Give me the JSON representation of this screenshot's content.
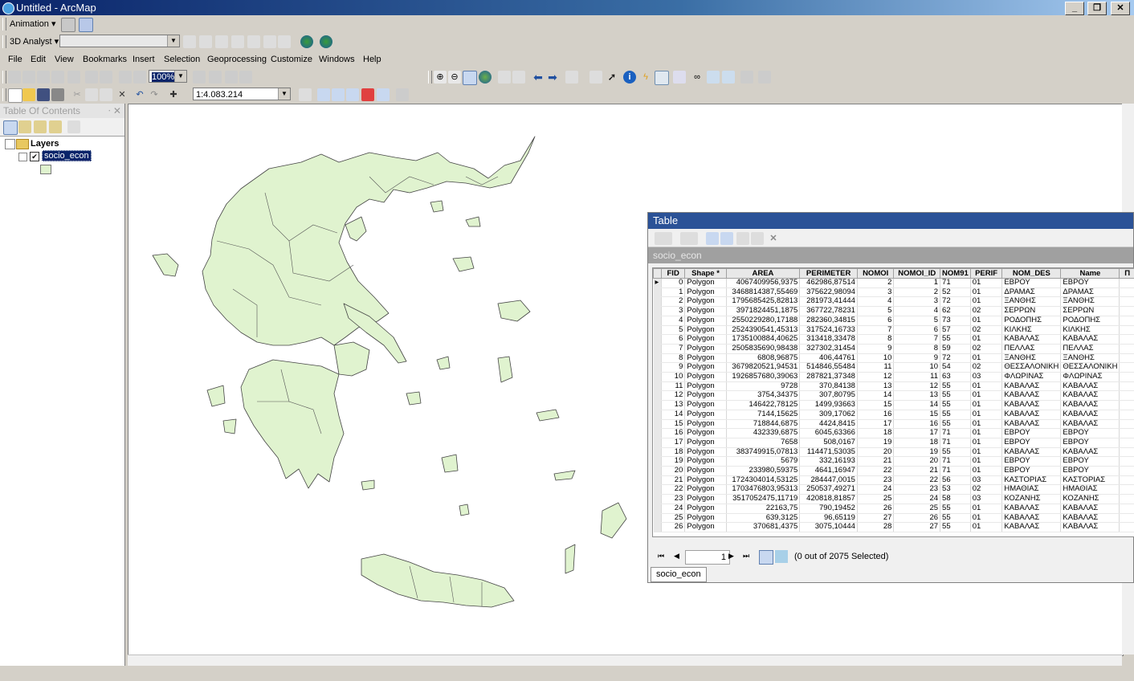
{
  "window": {
    "title": "Untitled - ArcMap",
    "min": "_",
    "max": "❐",
    "close": "✕"
  },
  "toolbar1": {
    "animation": "Animation ▾"
  },
  "toolbar2": {
    "analyst": "3D Analyst ▾"
  },
  "menu": [
    "File",
    "Edit",
    "View",
    "Bookmarks",
    "Insert",
    "Selection",
    "Geoprocessing",
    "Customize",
    "Windows",
    "Help"
  ],
  "zoom_percent": "100%",
  "scale": "1:4.083.214",
  "toc": {
    "title": "Table Of Contents",
    "pin": "ᐧ ✕",
    "root": "Layers",
    "layer": "socio_econ",
    "expand_root": "⊟",
    "expand_layer": "⊟",
    "check": "✔"
  },
  "table": {
    "window_title": "Table",
    "table_name": "socio_econ",
    "columns": [
      "FID",
      "Shape *",
      "AREA",
      "PERIMETER",
      "NOMOI",
      "NOMOI_ID",
      "NOM91",
      "PERIF",
      "NOM_DES",
      "Name",
      "Π"
    ],
    "rows": [
      [
        "0",
        "Polygon",
        "4067409956,9375",
        "462986,87514",
        "2",
        "1",
        "71",
        "01",
        "ΕΒΡΟΥ",
        "ΕΒΡΟΥ"
      ],
      [
        "1",
        "Polygon",
        "3468814387,55469",
        "375622,98094",
        "3",
        "2",
        "52",
        "01",
        "ΔΡΑΜΑΣ",
        "ΔΡΑΜΑΣ"
      ],
      [
        "2",
        "Polygon",
        "1795685425,82813",
        "281973,41444",
        "4",
        "3",
        "72",
        "01",
        "ΞΑΝΘΗΣ",
        "ΞΑΝΘΗΣ"
      ],
      [
        "3",
        "Polygon",
        "3971824451,1875",
        "367722,78231",
        "5",
        "4",
        "62",
        "02",
        "ΣΕΡΡΩΝ",
        "ΣΕΡΡΩΝ"
      ],
      [
        "4",
        "Polygon",
        "2550229280,17188",
        "282360,34815",
        "6",
        "5",
        "73",
        "01",
        "ΡΟΔΟΠΗΣ",
        "ΡΟΔΟΠΗΣ"
      ],
      [
        "5",
        "Polygon",
        "2524390541,45313",
        "317524,16733",
        "7",
        "6",
        "57",
        "02",
        "ΚΙΛΚΗΣ",
        "ΚΙΛΚΗΣ"
      ],
      [
        "6",
        "Polygon",
        "1735100884,40625",
        "313418,33478",
        "8",
        "7",
        "55",
        "01",
        "ΚΑΒΑΛΑΣ",
        "ΚΑΒΑΛΑΣ"
      ],
      [
        "7",
        "Polygon",
        "2505835690,98438",
        "327302,31454",
        "9",
        "8",
        "59",
        "02",
        "ΠΕΛΛΑΣ",
        "ΠΕΛΛΑΣ"
      ],
      [
        "8",
        "Polygon",
        "6808,96875",
        "406,44761",
        "10",
        "9",
        "72",
        "01",
        "ΞΑΝΘΗΣ",
        "ΞΑΝΘΗΣ"
      ],
      [
        "9",
        "Polygon",
        "3679820521,94531",
        "514846,55484",
        "11",
        "10",
        "54",
        "02",
        "ΘΕΣΣΑΛΟΝΙΚΗ",
        "ΘΕΣΣΑΛΟΝΙΚΗ"
      ],
      [
        "10",
        "Polygon",
        "1926857680,39063",
        "287821,37348",
        "12",
        "11",
        "63",
        "03",
        "ΦΛΩΡΙΝΑΣ",
        "ΦΛΩΡΙΝΑΣ"
      ],
      [
        "11",
        "Polygon",
        "9728",
        "370,84138",
        "13",
        "12",
        "55",
        "01",
        "ΚΑΒΑΛΑΣ",
        "ΚΑΒΑΛΑΣ"
      ],
      [
        "12",
        "Polygon",
        "3754,34375",
        "307,80795",
        "14",
        "13",
        "55",
        "01",
        "ΚΑΒΑΛΑΣ",
        "ΚΑΒΑΛΑΣ"
      ],
      [
        "13",
        "Polygon",
        "146422,78125",
        "1499,93663",
        "15",
        "14",
        "55",
        "01",
        "ΚΑΒΑΛΑΣ",
        "ΚΑΒΑΛΑΣ"
      ],
      [
        "14",
        "Polygon",
        "7144,15625",
        "309,17062",
        "16",
        "15",
        "55",
        "01",
        "ΚΑΒΑΛΑΣ",
        "ΚΑΒΑΛΑΣ"
      ],
      [
        "15",
        "Polygon",
        "718844,6875",
        "4424,8415",
        "17",
        "16",
        "55",
        "01",
        "ΚΑΒΑΛΑΣ",
        "ΚΑΒΑΛΑΣ"
      ],
      [
        "16",
        "Polygon",
        "432339,6875",
        "6045,63366",
        "18",
        "17",
        "71",
        "01",
        "ΕΒΡΟΥ",
        "ΕΒΡΟΥ"
      ],
      [
        "17",
        "Polygon",
        "7658",
        "508,0167",
        "19",
        "18",
        "71",
        "01",
        "ΕΒΡΟΥ",
        "ΕΒΡΟΥ"
      ],
      [
        "18",
        "Polygon",
        "383749915,07813",
        "114471,53035",
        "20",
        "19",
        "55",
        "01",
        "ΚΑΒΑΛΑΣ",
        "ΚΑΒΑΛΑΣ"
      ],
      [
        "19",
        "Polygon",
        "5679",
        "332,16193",
        "21",
        "20",
        "71",
        "01",
        "ΕΒΡΟΥ",
        "ΕΒΡΟΥ"
      ],
      [
        "20",
        "Polygon",
        "233980,59375",
        "4641,16947",
        "22",
        "21",
        "71",
        "01",
        "ΕΒΡΟΥ",
        "ΕΒΡΟΥ"
      ],
      [
        "21",
        "Polygon",
        "1724304014,53125",
        "284447,0015",
        "23",
        "22",
        "56",
        "03",
        "ΚΑΣΤΟΡΙΑΣ",
        "ΚΑΣΤΟΡΙΑΣ"
      ],
      [
        "22",
        "Polygon",
        "1703476803,95313",
        "250537,49271",
        "24",
        "23",
        "53",
        "02",
        "ΗΜΑΘΙΑΣ",
        "ΗΜΑΘΙΑΣ"
      ],
      [
        "23",
        "Polygon",
        "3517052475,11719",
        "420818,81857",
        "25",
        "24",
        "58",
        "03",
        "ΚΟΖΑΝΗΣ",
        "ΚΟΖΑΝΗΣ"
      ],
      [
        "24",
        "Polygon",
        "22163,75",
        "790,19452",
        "26",
        "25",
        "55",
        "01",
        "ΚΑΒΑΛΑΣ",
        "ΚΑΒΑΛΑΣ"
      ],
      [
        "25",
        "Polygon",
        "639,3125",
        "96,65119",
        "27",
        "26",
        "55",
        "01",
        "ΚΑΒΑΛΑΣ",
        "ΚΑΒΑΛΑΣ"
      ],
      [
        "26",
        "Polygon",
        "370681,4375",
        "3075,10444",
        "28",
        "27",
        "55",
        "01",
        "ΚΑΒΑΛΑΣ",
        "ΚΑΒΑΛΑΣ"
      ]
    ],
    "nav": {
      "first": "⏮",
      "prev": "◀",
      "page": "1",
      "next": "▶",
      "last": "⏭",
      "status": "(0 out of 2075 Selected)"
    },
    "tab": "socio_econ"
  },
  "colors": {
    "polygon_fill": "#e0f3cf",
    "polygon_stroke": "#444444",
    "titlebar": "#0a246a",
    "table_title": "#2b5297"
  }
}
